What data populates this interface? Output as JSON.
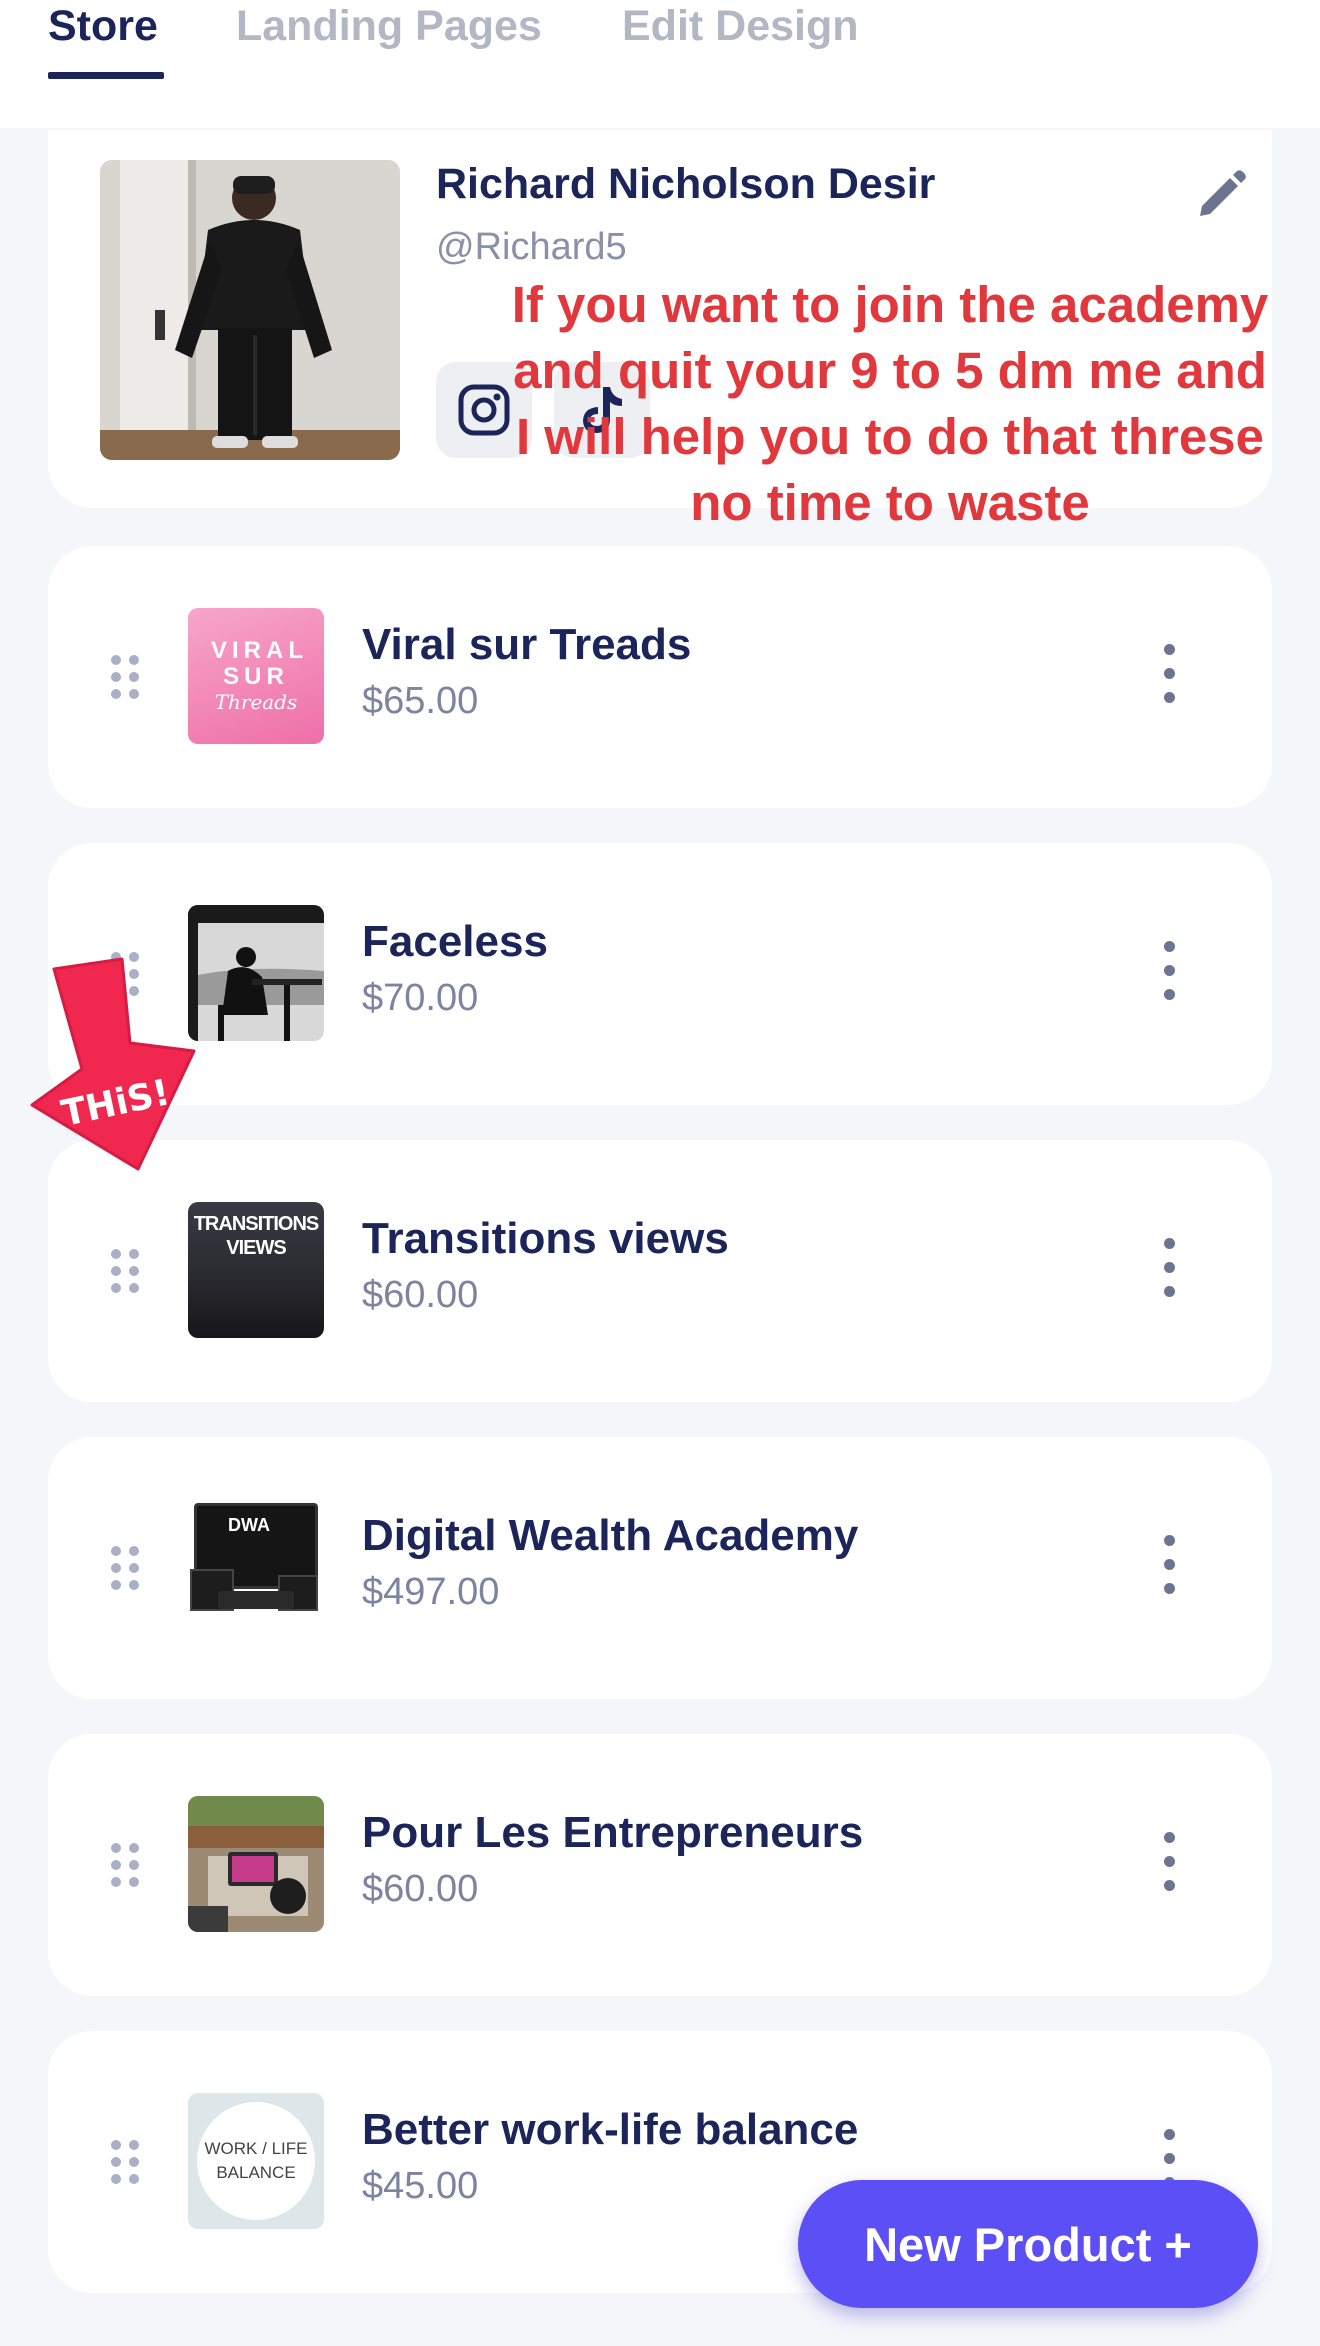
{
  "tabs": [
    {
      "label": "Store",
      "active": true
    },
    {
      "label": "Landing Pages",
      "active": false
    },
    {
      "label": "Edit Design",
      "active": false
    }
  ],
  "profile": {
    "name": "Richard Nicholson Desir",
    "handle": "@Richard5",
    "socials": [
      "instagram-icon",
      "tiktok-icon"
    ]
  },
  "overlay": {
    "text": "If you want to join the academy and quit your 9 to 5 dm me and I will help you to do that threse no time to waste",
    "color": "#e0383c"
  },
  "annotation": {
    "arrow_label": "THiS!"
  },
  "thumbnails": {
    "viral": "VIRAL SUR",
    "viral_script": "Threads",
    "transitions_1": "TRANSITIONS",
    "transitions_2": "VIEWS",
    "dwa": "DWA",
    "worklife_1": "WORK / LIFE",
    "worklife_2": "BALANCE"
  },
  "products": [
    {
      "name": "Viral sur Treads",
      "price": "$65.00"
    },
    {
      "name": "Faceless",
      "price": "$70.00"
    },
    {
      "name": "Transitions views",
      "price": "$60.00"
    },
    {
      "name": "Digital Wealth Academy",
      "price": "$497.00"
    },
    {
      "name": "Pour Les Entrepreneurs",
      "price": "$60.00"
    },
    {
      "name": "Better work-life balance",
      "price": "$45.00"
    }
  ],
  "new_product_button": "New Product +",
  "colors": {
    "accent": "#5b4ff5",
    "text_primary": "#1b2559",
    "text_secondary": "#7c84a0",
    "annotation_red": "#e0383c",
    "arrow_pink": "#f0284f"
  }
}
